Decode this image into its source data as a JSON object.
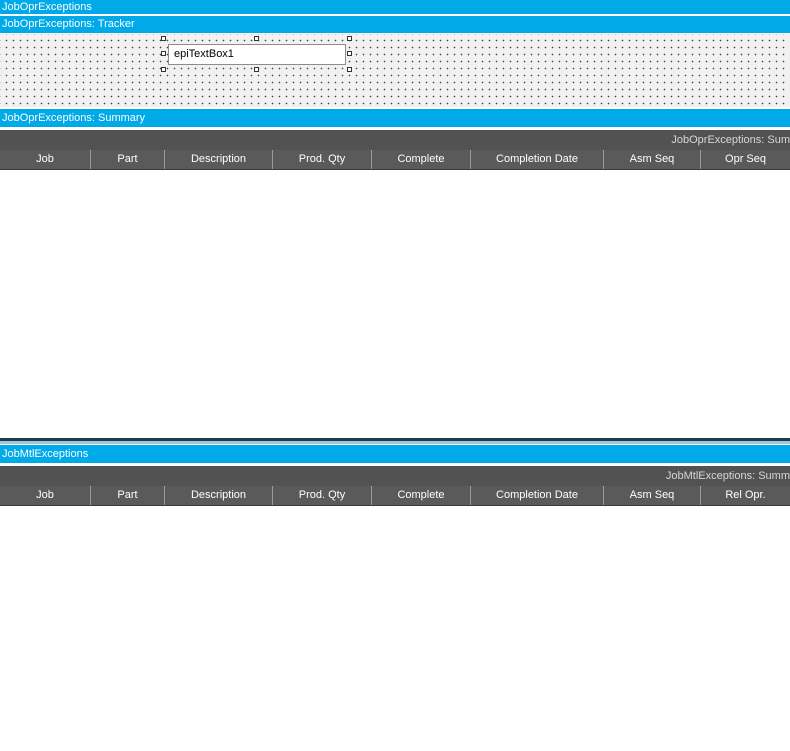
{
  "panels": {
    "opr_root_title": "JobOprExceptions",
    "tracker_title": "JobOprExceptions: Tracker",
    "summary_title": "JobOprExceptions: Summary",
    "mtl_title": "JobMtlExceptions"
  },
  "tracker": {
    "textbox_label": "epiTextBox1"
  },
  "opr_grid": {
    "caption": "JobOprExceptions: Sum",
    "columns": [
      "Job",
      "Part",
      "Description",
      "Prod. Qty",
      "Complete",
      "Completion Date",
      "Asm Seq",
      "Opr Seq"
    ]
  },
  "mtl_grid": {
    "caption": "JobMtlExceptions: Summ",
    "columns": [
      "Job",
      "Part",
      "Description",
      "Prod. Qty",
      "Complete",
      "Completion Date",
      "Asm Seq",
      "Rel Opr."
    ]
  },
  "colors": {
    "title_bar": "#00a9e8",
    "grid_header": "#5a5a5a",
    "divider": "#1f3b4d"
  }
}
